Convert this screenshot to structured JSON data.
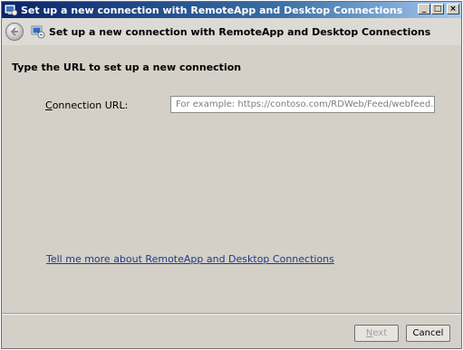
{
  "window": {
    "title": "Set up a new connection with RemoteApp and Desktop Connections",
    "controls": {
      "minimize": "_",
      "maximize": "□",
      "close": "×"
    }
  },
  "header": {
    "back_icon": "back-arrow-icon",
    "title": "Set up a new connection with RemoteApp and Desktop Connections"
  },
  "content": {
    "instruction": "Type the URL to set up a new connection",
    "url_label_accel": "C",
    "url_label_rest": "onnection URL:",
    "url_value": "",
    "url_placeholder": "For example: https://contoso.com/RDWeb/Feed/webfeed.aspx",
    "help_link": "Tell me more about RemoteApp and Desktop Connections"
  },
  "footer": {
    "next_accel": "N",
    "next_rest": "ext",
    "cancel": "Cancel"
  }
}
